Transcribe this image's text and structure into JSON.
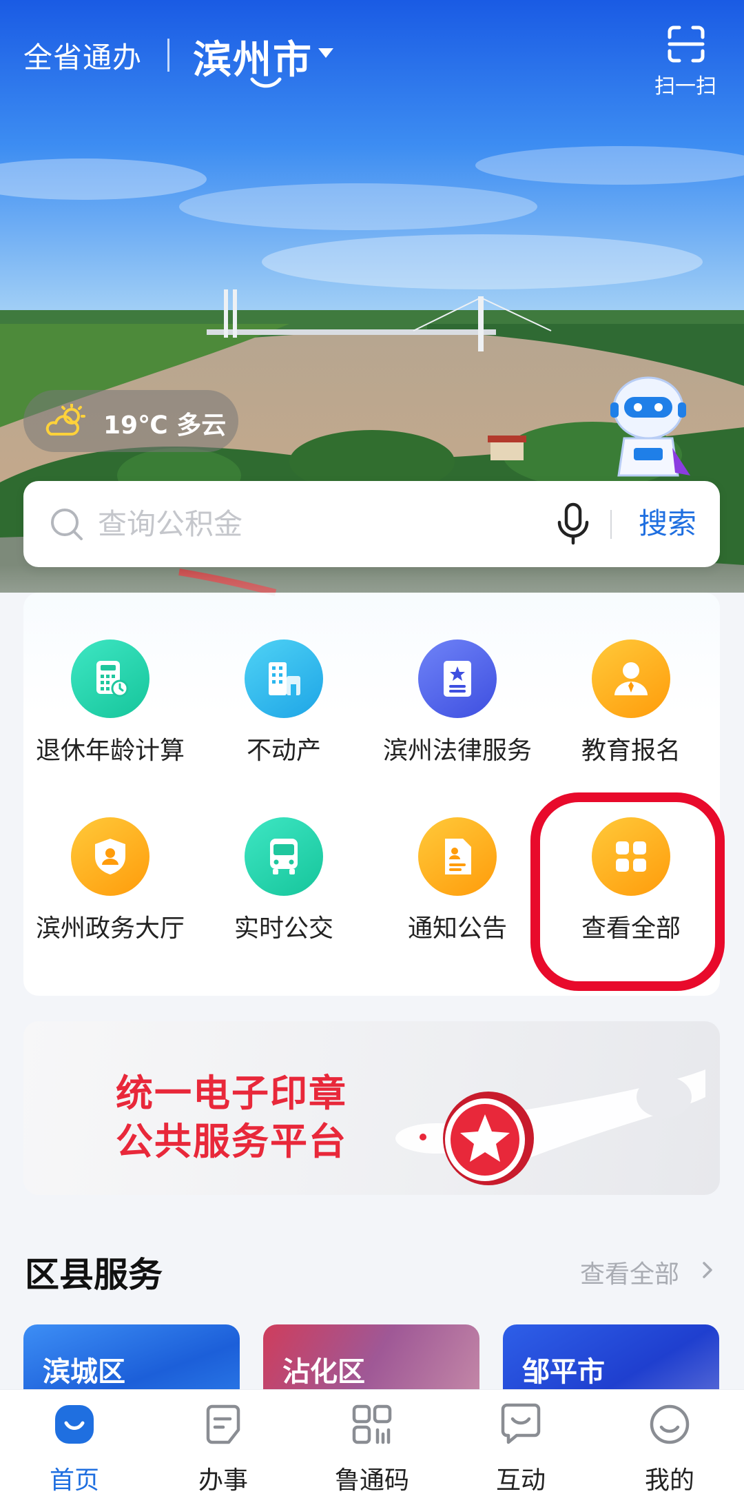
{
  "header": {
    "province_label": "全省通办",
    "city": "滨州市",
    "scan_label": "扫一扫"
  },
  "weather": {
    "text": "19℃ 多云",
    "icon": "partly-cloudy-icon"
  },
  "search": {
    "placeholder": "查询公积金",
    "button_label": "搜索"
  },
  "services": [
    {
      "label": "退休年龄计算",
      "icon": "calculator-icon",
      "color": "#1fd3ab"
    },
    {
      "label": "不动产",
      "icon": "building-icon",
      "color": "#2bb7ee"
    },
    {
      "label": "滨州法律服务",
      "icon": "law-book-icon",
      "color": "#4a5ce8"
    },
    {
      "label": "教育报名",
      "icon": "student-icon",
      "color": "#ffae1c"
    },
    {
      "label": "滨州政务大厅",
      "icon": "shield-user-icon",
      "color": "#ffae1c"
    },
    {
      "label": "实时公交",
      "icon": "bus-icon",
      "color": "#1fd3ab"
    },
    {
      "label": "通知公告",
      "icon": "document-icon",
      "color": "#ffae1c"
    },
    {
      "label": "查看全部",
      "icon": "grid-icon",
      "color": "#ffae1c"
    }
  ],
  "banner": {
    "line1": "统一电子印章",
    "line2": "公共服务平台"
  },
  "districts_section": {
    "title": "区县服务",
    "view_all": "查看全部",
    "items": [
      {
        "name": "滨城区"
      },
      {
        "name": "沾化区"
      },
      {
        "name": "邹平市"
      }
    ]
  },
  "bottom_nav": [
    {
      "label": "首页",
      "icon": "home-icon",
      "active": true
    },
    {
      "label": "办事",
      "icon": "tasks-icon",
      "active": false
    },
    {
      "label": "鲁通码",
      "icon": "qr-code-icon",
      "active": false
    },
    {
      "label": "互动",
      "icon": "chat-icon",
      "active": false
    },
    {
      "label": "我的",
      "icon": "profile-icon",
      "active": false
    }
  ],
  "colors": {
    "accent": "#1f6fe0",
    "highlight_ring": "#e80a2b",
    "banner_text": "#e8283a"
  }
}
